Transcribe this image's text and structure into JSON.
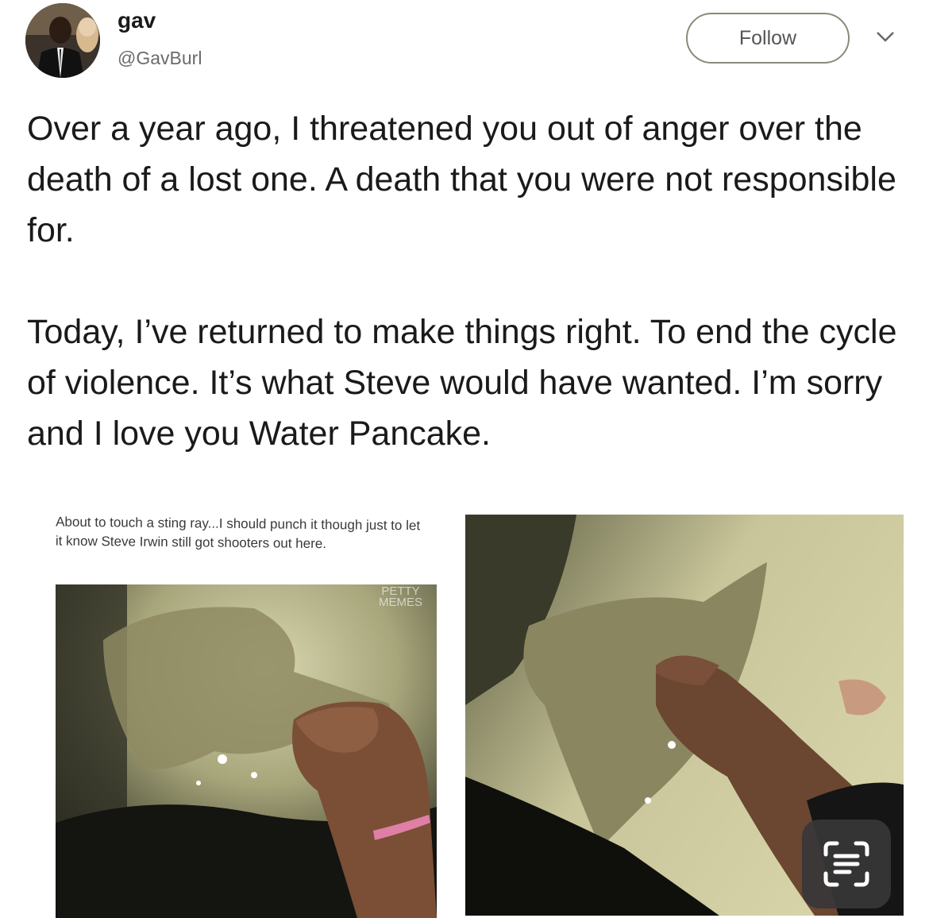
{
  "user": {
    "name": "gav",
    "handle": "@GavBurl"
  },
  "follow_label": "Follow",
  "tweet": {
    "paragraphs": [
      "Over a year ago, I threatened you out of anger over the death of a lost one. A death that you were not responsible for.",
      "Today, I’ve returned to make things right. To end the cycle of violence. It’s what Steve would have wanted. I’m sorry and I love you Water Pancake."
    ]
  },
  "meme": {
    "caption": "About to touch a sting ray...I should punch it though just to let it know Steve Irwin still got shooters out here.",
    "watermark_line1": "PETTY",
    "watermark_line2": "MEMES"
  },
  "icons": {
    "caret": "chevron-down-icon",
    "scan": "text-scan-icon"
  },
  "colors": {
    "follow_border": "#8a8a7a",
    "handle": "#6b6b6b"
  }
}
